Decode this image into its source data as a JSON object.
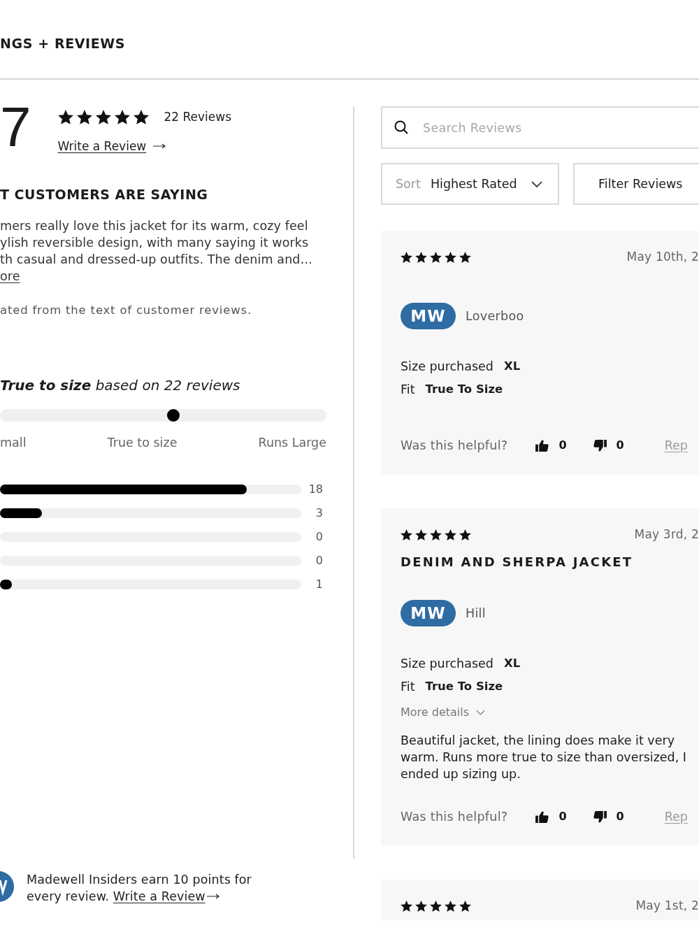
{
  "section_title": "NGS + REVIEWS",
  "rating": {
    "value": "7",
    "stars": 5,
    "review_count": "22 Reviews",
    "write_review_link": "Write a Review"
  },
  "summary": {
    "title": "T CUSTOMERS ARE SAYING",
    "lines": [
      "mers really love this jacket for its warm, cozy feel",
      "ylish reversible design, with many saying it works",
      "th casual and dressed-up outfits. The denim and…"
    ],
    "more_link": "ore",
    "note": "ated from the text of customer reviews."
  },
  "fit": {
    "heading": "**True to size** based on 22 reviews",
    "level": 0.53,
    "labels": [
      "mall",
      "True to size",
      "Runs Large"
    ]
  },
  "distribution": [
    {
      "level": 0.82,
      "count": "18"
    },
    {
      "level": 0.14,
      "count": "3"
    },
    {
      "count": "0"
    },
    {
      "count": "0"
    },
    {
      "level": 0.04,
      "count": "1"
    }
  ],
  "promo": {
    "text": "Madewell Insiders earn 10 points for every review.",
    "link": "Write a Review"
  },
  "search": {
    "placeholder": "Search Reviews"
  },
  "sort": {
    "label": "Sort",
    "value": "Highest Rated"
  },
  "filter_button": "Filter Reviews",
  "reviews": [
    {
      "stars": 5,
      "date": "May 10th, 2",
      "initials": "MW",
      "author": "Loverboo",
      "details": [
        {
          "label": "Size purchased",
          "value": "XL"
        },
        {
          "label": "Fit",
          "value": "True To Size"
        }
      ],
      "helpful": {
        "label": "Was this helpful?",
        "up": "0",
        "down": "0",
        "report": "Rep"
      }
    },
    {
      "stars": 5,
      "date": "May 3rd, 2",
      "title": "DENIM AND SHERPA JACKET",
      "initials": "MW",
      "author": "Hill",
      "details": [
        {
          "label": "Size purchased",
          "value": "XL"
        },
        {
          "label": "Fit",
          "value": "True To Size"
        }
      ],
      "more_details": "More details",
      "body": "Beautiful jacket, the lining does make it very warm. Runs more true to size than oversized, I ended up sizing up.",
      "helpful": {
        "label": "Was this helpful?",
        "up": "0",
        "down": "0",
        "report": "Rep"
      }
    },
    {
      "stars": 5,
      "date": "May 1st, 2"
    }
  ]
}
